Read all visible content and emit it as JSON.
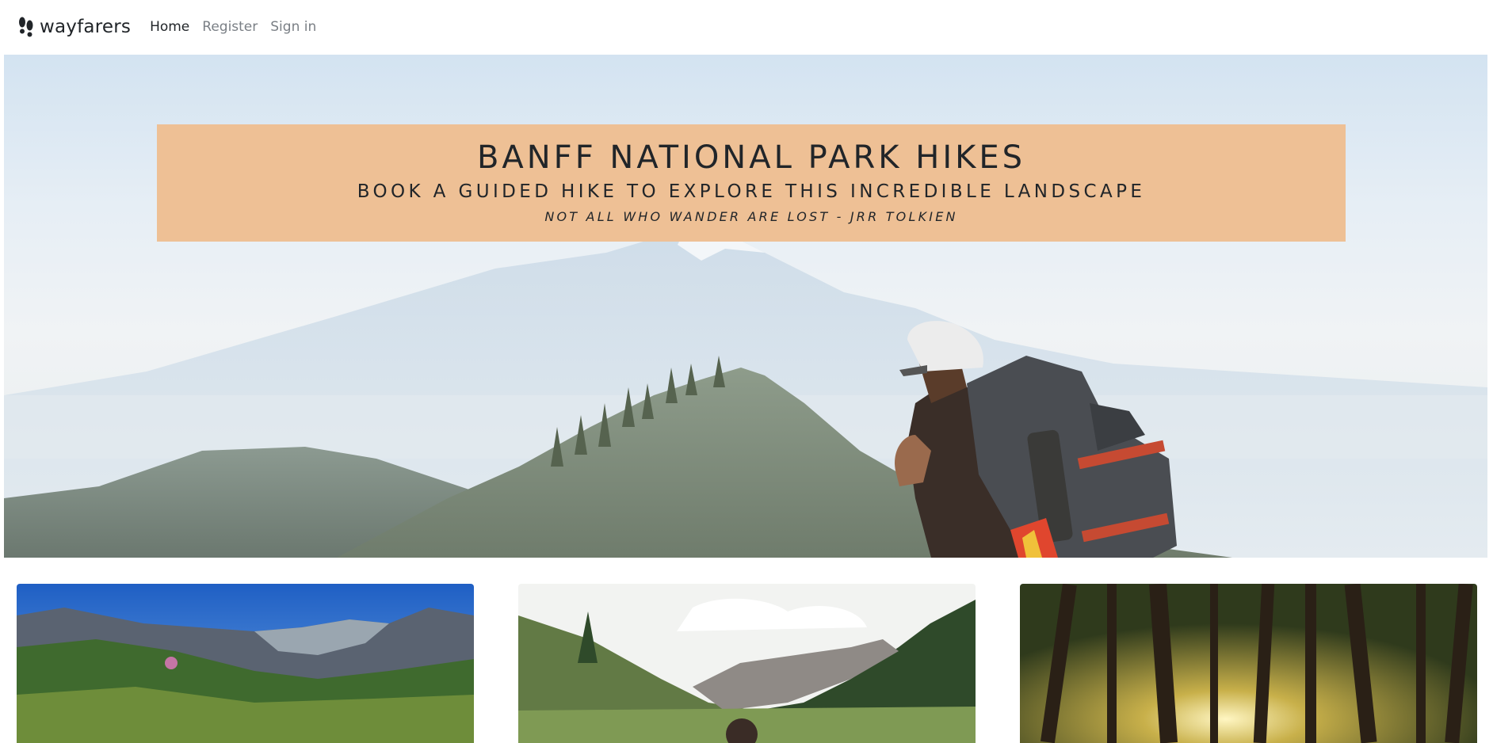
{
  "navbar": {
    "brand": "wayfarers",
    "brand_icon": "footprints-icon",
    "links": [
      {
        "label": "Home",
        "active": true
      },
      {
        "label": "Register",
        "active": false
      },
      {
        "label": "Sign in",
        "active": false
      }
    ]
  },
  "hero": {
    "title": "BANFF NATIONAL PARK HIKES",
    "subtitle": "BOOK A GUIDED HIKE TO EXPLORE THIS INCREDIBLE LANDSCAPE",
    "quote": "NOT ALL WHO WANDER ARE LOST - JRR TOLKIEN",
    "banner_color": "#eec095"
  },
  "cards": [
    {
      "image": "mountain-meadow-photo"
    },
    {
      "image": "valley-hiker-photo"
    },
    {
      "image": "forest-sunlight-photo"
    }
  ]
}
